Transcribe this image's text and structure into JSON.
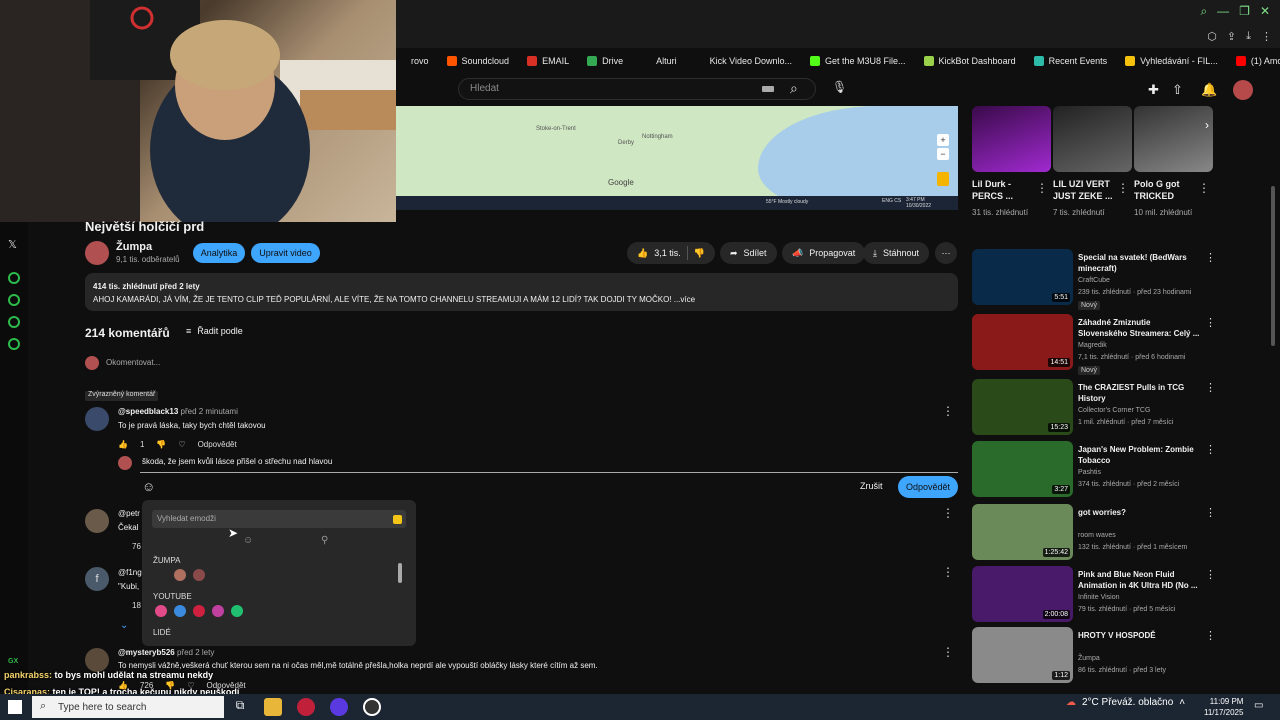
{
  "browser": {
    "bookmarks": [
      {
        "label": "rovo",
        "color": "transparent"
      },
      {
        "label": "Soundcloud",
        "color": "#ff5500"
      },
      {
        "label": "EMAIL",
        "color": "#d93025"
      },
      {
        "label": "Drive",
        "color": "#34a853"
      },
      {
        "label": "Alturi",
        "color": "transparent"
      },
      {
        "label": "Kick Video Downlo...",
        "color": "transparent"
      },
      {
        "label": "Get the M3U8 File...",
        "color": "#53fc18"
      },
      {
        "label": "KickBot Dashboard",
        "color": "#9ad14b"
      },
      {
        "label": "Recent Events",
        "color": "#2dbbaa"
      },
      {
        "label": "Vyhledávání - FIL...",
        "color": "#f4c20d"
      },
      {
        "label": "(1) Among the Slee...",
        "color": "#ff0000"
      }
    ]
  },
  "header": {
    "search_placeholder": "Hledat"
  },
  "video": {
    "title": "Největší holčičí prd",
    "channel": "Žumpa",
    "subscribers": "9,1 tis. odběratelů",
    "btn_analytics": "Analytika",
    "btn_edit": "Upravit video",
    "likes": "3,1 tis.",
    "btn_share": "Sdílet",
    "btn_promote": "Propagovat",
    "btn_download": "Stáhnout",
    "desc_stats": "414 tis. zhlédnutí  před 2 lety",
    "desc_text": "AHOJ KAMARÁDI, JÁ VÍM, ŽE JE TENTO CLIP TEĎ POPULÁRNÍ, ALE VÍTE, ŽE NA TOMTO CHANNELU STREAMUJI A MÁM 12 LIDÍ? TAK DOJDI TY MOČKO! ...více",
    "map_weather": "55°F  Mostly cloudy",
    "map_time": "3:47 PM",
    "map_date": "10/30/2022",
    "map_lang": "ENG CS"
  },
  "comments": {
    "count": "214 komentářů",
    "sort_label": "Řadit podle",
    "add_placeholder": "Okomentovat...",
    "pinned_label": "Zvýrazněný komentář",
    "items": [
      {
        "author": "@speedblack13",
        "time": "před 2 minutami",
        "text": "To je pravá láska, taky bych chtěl takovou",
        "likes": "1",
        "reply": "Odpovědět"
      },
      {
        "author": "@petr",
        "time": "",
        "text": "Čekal",
        "likes": "76",
        "reply": ""
      },
      {
        "author": "@f1ng",
        "time": "",
        "text": "\"Kubi,",
        "likes": "18",
        "reply": ""
      },
      {
        "author": "@mysteryb526",
        "time": "před 2 lety",
        "text": "To nemysli vážně,veškerá chuť kterou sem na ni očas měl,mě totálně přešla,holka neprdí ale vypouští obláčky lásky které cítím až sem.",
        "likes": "726",
        "reply": "Odpovědět"
      }
    ],
    "reply_draft": "škoda, že jsem kvůli lásce přišel o střechu nad hlavou",
    "btn_cancel": "Zrušit",
    "btn_reply": "Odpovědět",
    "avatar_letter": "f"
  },
  "emoji_picker": {
    "search_placeholder": "Vyhledat emodži",
    "section_channel": "ŽUMPA",
    "section_youtube": "YOUTUBE",
    "section_people": "LIDÉ"
  },
  "shorts": [
    {
      "title": "Lil Durk - PERCS ...",
      "views": "31 tis. zhlédnutí"
    },
    {
      "title": "LIL UZI VERT JUST ZEKE ...",
      "views": "7 tis. zhlédnutí"
    },
    {
      "title": "Polo G got TRICKED",
      "views": "10 mil. zhlédnutí"
    }
  ],
  "recommendations": [
    {
      "title": "Special na svatek! (BedWars minecraft)",
      "channel": "CraftCube",
      "meta": "239 tis. zhlédnutí · před 23 hodinami",
      "badge": "Nový",
      "duration": "5:51",
      "color": "#0a2a4a"
    },
    {
      "title": "Záhadné Zmiznutie Slovenského Streamera: Celý ...",
      "channel": "Magredik",
      "meta": "7,1 tis. zhlédnutí · před 6 hodinami",
      "badge": "Nový",
      "duration": "14:51",
      "color": "#8a1a1a"
    },
    {
      "title": "The CRAZIEST Pulls in TCG History",
      "channel": "Collector's Corner TCG",
      "meta": "1 mil. zhlédnutí · před 7 měsíci",
      "badge": "",
      "duration": "15:23",
      "color": "#2a4a1a"
    },
    {
      "title": "Japan's New Problem: Zombie Tobacco",
      "channel": "Pashtis",
      "meta": "374 tis. zhlédnutí · před 2 měsíci",
      "badge": "",
      "duration": "3:27",
      "color": "#2a6a2a"
    },
    {
      "title": "got worries?",
      "channel": "room waves",
      "meta": "132 tis. zhlédnutí · před 1 měsícem",
      "badge": "",
      "duration": "1:25:42",
      "color": "#6a8a5a"
    },
    {
      "title": "Pink and Blue Neon Fluid Animation in 4K Ultra HD (No ...",
      "channel": "Infinite Vision",
      "meta": "79 tis. zhlédnutí · před 5 měsíci",
      "badge": "",
      "duration": "2:00:08",
      "color": "#4a1a6a"
    },
    {
      "title": "HROTY V HOSPODĚ",
      "channel": "Žumpa",
      "meta": "86 tis. zhlédnutí · před 3 lety",
      "badge": "",
      "duration": "1:12",
      "color": "#8a8a8a"
    }
  ],
  "chat": [
    {
      "name": "pankrabss:",
      "text": "to bys mohl udělat na streamu nekdy"
    },
    {
      "name": "Cisaranas:",
      "text": "ten je TOP! a trocha kečupu nikdy neuškodí"
    }
  ],
  "taskbar": {
    "search_placeholder": "Type here to search",
    "weather": "2°C  Převáž. oblačno",
    "time": "11:09 PM",
    "date": "11/17/2025",
    "notif": "2"
  },
  "gx_label": "GX"
}
